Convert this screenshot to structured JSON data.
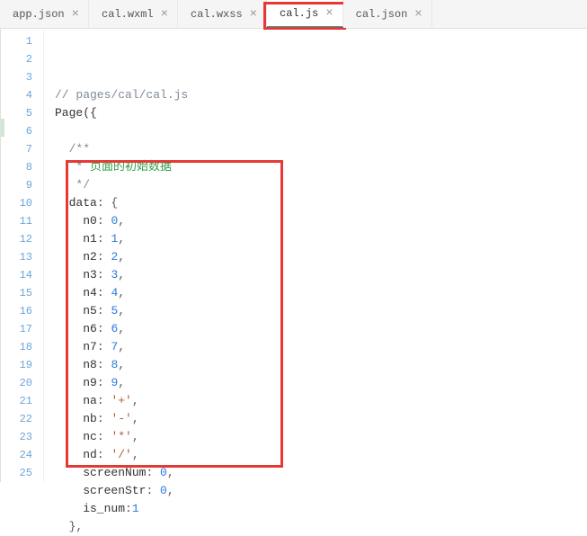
{
  "tabs": [
    {
      "label": "app.json",
      "active": false
    },
    {
      "label": "cal.wxml",
      "active": false
    },
    {
      "label": "cal.wxss",
      "active": false
    },
    {
      "label": "cal.js",
      "active": true,
      "highlighted": true
    },
    {
      "label": "cal.json",
      "active": false
    }
  ],
  "close_symbol": "×",
  "gutter_lines": [
    "1",
    "2",
    "3",
    "4",
    "5",
    "6",
    "7",
    "8",
    "9",
    "10",
    "11",
    "12",
    "13",
    "14",
    "15",
    "16",
    "17",
    "18",
    "19",
    "20",
    "21",
    "22",
    "23",
    "24",
    "25"
  ],
  "code": {
    "l1_comment": "// pages/cal/cal.js",
    "l2_text": "Page({",
    "l4_text": "  /**",
    "l5_star": "   * ",
    "l5_doc": "页面的初始数据",
    "l6_text": "   */",
    "l7_key": "  data",
    "colon_brace": ": {",
    "entries": [
      {
        "k": "n0",
        "v": "0",
        "t": "num"
      },
      {
        "k": "n1",
        "v": "1",
        "t": "num"
      },
      {
        "k": "n2",
        "v": "2",
        "t": "num"
      },
      {
        "k": "n3",
        "v": "3",
        "t": "num"
      },
      {
        "k": "n4",
        "v": "4",
        "t": "num"
      },
      {
        "k": "n5",
        "v": "5",
        "t": "num"
      },
      {
        "k": "n6",
        "v": "6",
        "t": "num"
      },
      {
        "k": "n7",
        "v": "7",
        "t": "num"
      },
      {
        "k": "n8",
        "v": "8",
        "t": "num"
      },
      {
        "k": "n9",
        "v": "9",
        "t": "num"
      },
      {
        "k": "na",
        "v": "'+'",
        "t": "str"
      },
      {
        "k": "nb",
        "v": "'-'",
        "t": "str"
      },
      {
        "k": "nc",
        "v": "'*'",
        "t": "str"
      },
      {
        "k": "nd",
        "v": "'/'",
        "t": "str"
      },
      {
        "k": "screenNum",
        "v": "0",
        "t": "num"
      },
      {
        "k": "screenStr",
        "v": "0",
        "t": "num"
      }
    ],
    "l24_key": "    is_num",
    "l24_colon": ":",
    "l24_val": "1",
    "l25_text": "  },",
    "entry_indent": "    ",
    "entry_sep": ": ",
    "entry_comma": ","
  }
}
